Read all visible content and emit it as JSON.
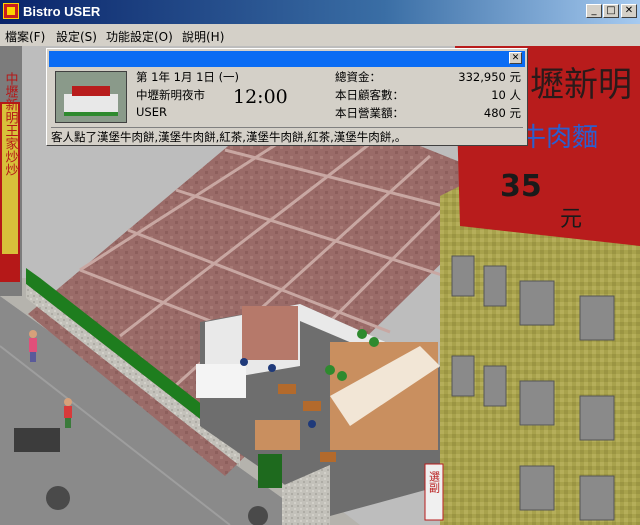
{
  "window": {
    "title": "Bistro USER",
    "minimize_glyph": "_",
    "maximize_glyph": "□",
    "close_glyph": "✕"
  },
  "menu": [
    {
      "label": "檔案(F)"
    },
    {
      "label": "設定(S)"
    },
    {
      "label": "功能設定(O)"
    },
    {
      "label": "說明(H)"
    }
  ],
  "info": {
    "date": "第 1年  1月  1日 (一)",
    "location": "中壢新明夜市",
    "player": "USER",
    "time": "12:00",
    "funds_label": "總資金：",
    "funds_value": "332,950 元",
    "customers_label": "本日顧客數：",
    "customers_value": "10 人",
    "sales_label": "本日營業額：",
    "sales_value": "480 元",
    "message": "客人點了漢堡牛肉餅,漢堡牛肉餅,紅茶,漢堡牛肉餅,紅茶,漢堡牛肉餅,。",
    "close_glyph": "✕"
  },
  "scene": {
    "sign_left": "中壢新明王家炒炒",
    "sign_right_big": "壢新明",
    "sign_right_sub": "牛肉麵",
    "sign_right_price": "35",
    "sign_right_unit": "元",
    "sign_bottom": "選副",
    "colors": {
      "sky": "#bfbfbf",
      "street": "#8c8c8c",
      "sidewalk": "#b6b4ae",
      "roof": "#9b6c6a",
      "awning": "#1d7a1d",
      "building_red": "#b81c1c",
      "building_green": "#a9a24a"
    }
  }
}
